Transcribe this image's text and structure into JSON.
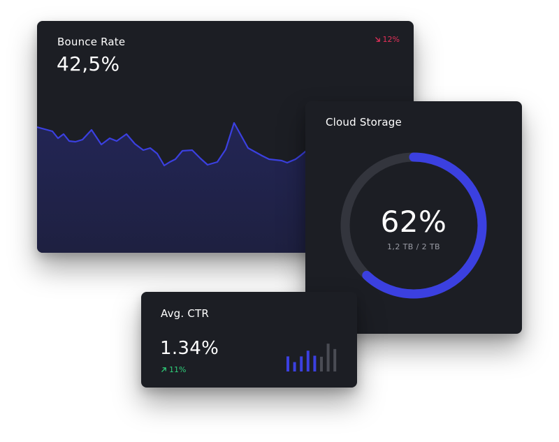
{
  "bounce": {
    "title": "Bounce Rate",
    "value": "42,5%",
    "delta": "12%",
    "delta_icon": "arrow-down-right-icon",
    "delta_color": "#e5305a",
    "line_color": "#3b40e0",
    "fill_color": "#1e2040"
  },
  "storage": {
    "title": "Cloud Storage",
    "percent_label": "62%",
    "percent_value": 62,
    "used_label": "1,2 TB / 2 TB",
    "ring_color": "#3b40e0",
    "track_color": "#33353d"
  },
  "ctr": {
    "title": "Avg. CTR",
    "value": "1.34%",
    "delta": "11%",
    "delta_icon": "arrow-up-right-icon",
    "delta_color": "#2fcf7a",
    "bar_values": [
      0.45,
      0.28,
      0.45,
      0.62,
      0.47,
      0.44,
      0.83,
      0.67
    ],
    "bar_highlight": [
      true,
      true,
      true,
      true,
      true,
      false,
      false,
      false
    ]
  }
}
